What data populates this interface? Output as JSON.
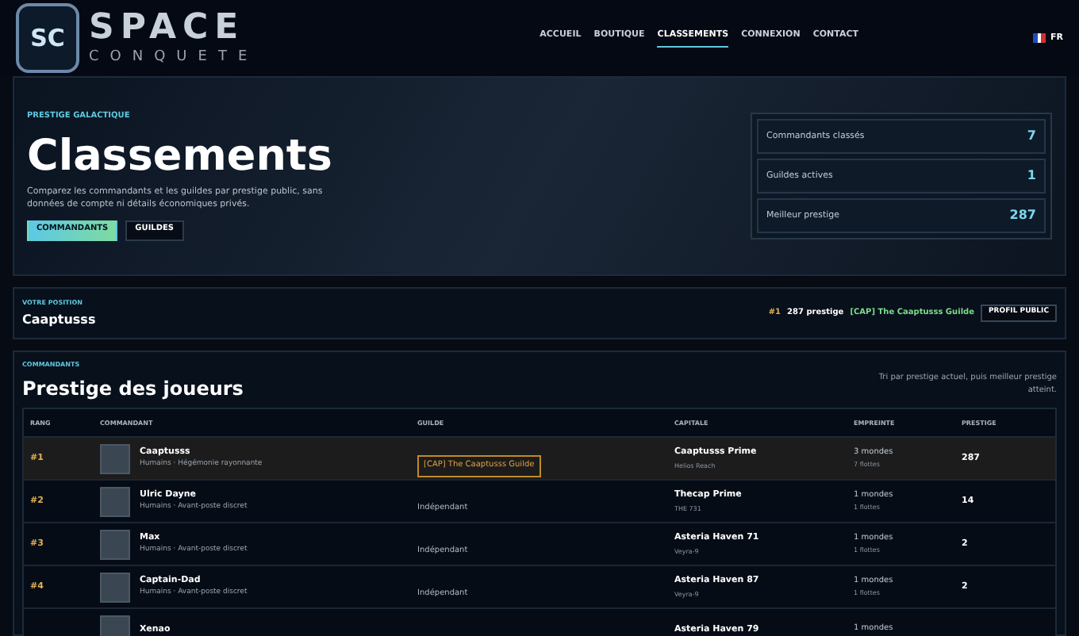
{
  "logo": {
    "title": "SPACE",
    "subtitle": "CONQUETE",
    "emblem": "SC"
  },
  "nav": [
    {
      "label": "ACCUEIL",
      "selected": false
    },
    {
      "label": "BOUTIQUE",
      "selected": false
    },
    {
      "label": "CLASSEMENTS",
      "selected": true
    },
    {
      "label": "CONNEXION",
      "selected": false
    },
    {
      "label": "CONTACT",
      "selected": false
    }
  ],
  "language": "FR",
  "hero": {
    "eyebrow": "PRESTIGE GALACTIQUE",
    "title": "Classements",
    "description": "Comparez les commandants et les guildes par prestige public, sans données de compte ni détails économiques privés.",
    "tabs": [
      {
        "label": "COMMANDANTS",
        "selected": true
      },
      {
        "label": "GUILDES",
        "selected": false
      }
    ],
    "stats": [
      {
        "label": "Commandants classés",
        "value": "7"
      },
      {
        "label": "Guildes actives",
        "value": "1"
      },
      {
        "label": "Meilleur prestige",
        "value": "287"
      }
    ]
  },
  "position": {
    "eyebrow": "VOTRE POSITION",
    "name": "Caaptusss",
    "rank": "#1",
    "prestige": "287 prestige",
    "guild": "[CAP] The Caaptusss Guilde",
    "button": "PROFIL PUBLIC"
  },
  "ranking": {
    "eyebrow": "COMMANDANTS",
    "title": "Prestige des joueurs",
    "note": "Tri par prestige actuel, puis meilleur prestige atteint.",
    "columns": [
      "RANG",
      "COMMANDANT",
      "GUILDE",
      "CAPITALE",
      "EMPREINTE",
      "PRESTIGE"
    ],
    "rows": [
      {
        "rank": "#1",
        "name": "Caaptusss",
        "subtitle": "Humains · Hégémonie rayonnante",
        "guild": {
          "kind": "tag",
          "text": "[CAP] The Caaptusss Guilde"
        },
        "capital": "Caaptusss Prime",
        "location": "Helios Reach",
        "worlds": "3 mondes",
        "fleets": "7 flottes",
        "prestige": "287",
        "selected": true
      },
      {
        "rank": "#2",
        "name": "Ulric Dayne",
        "subtitle": "Humains · Avant-poste discret",
        "guild": {
          "kind": "plain",
          "text": "Indépendant"
        },
        "capital": "Thecap Prime",
        "location": "THE 731",
        "worlds": "1 mondes",
        "fleets": "1 flottes",
        "prestige": "14",
        "selected": false
      },
      {
        "rank": "#3",
        "name": "Max",
        "subtitle": "Humains · Avant-poste discret",
        "guild": {
          "kind": "plain",
          "text": "Indépendant"
        },
        "capital": "Asteria Haven 71",
        "location": "Veyra-9",
        "worlds": "1 mondes",
        "fleets": "1 flottes",
        "prestige": "2",
        "selected": false
      },
      {
        "rank": "#4",
        "name": "Captain-Dad",
        "subtitle": "Humains · Avant-poste discret",
        "guild": {
          "kind": "plain",
          "text": "Indépendant"
        },
        "capital": "Asteria Haven 87",
        "location": "Veyra-9",
        "worlds": "1 mondes",
        "fleets": "1 flottes",
        "prestige": "2",
        "selected": false
      },
      {
        "name": "Xenao",
        "capital": "Asteria Haven 79",
        "worlds": "1 mondes",
        "selected": false
      }
    ]
  }
}
